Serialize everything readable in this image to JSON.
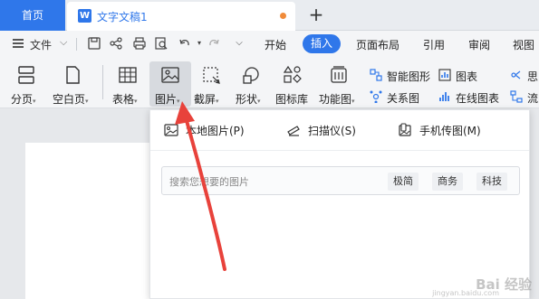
{
  "tabs": {
    "home": "首页",
    "document": "文字文稿1",
    "doc_icon": "W",
    "new_tab_icon": "+"
  },
  "menu": {
    "file": "文件",
    "items": [
      "开始",
      "插入",
      "页面布局",
      "引用",
      "审阅",
      "视图"
    ],
    "active": "插入"
  },
  "ribbon": {
    "buttons": [
      "分页",
      "空白页",
      "表格",
      "图片",
      "截屏",
      "形状",
      "图标库",
      "功能图"
    ],
    "small_right": [
      "智能图形",
      "关系图",
      "图表",
      "在线图表"
    ],
    "edge_labels": [
      "思",
      "流"
    ]
  },
  "dropdown": {
    "items": [
      "本地图片(P)",
      "扫描仪(S)",
      "手机传图(M)"
    ],
    "search_placeholder": "搜索您想要的图片",
    "tags": [
      "极简",
      "商务",
      "科技"
    ]
  },
  "colors": {
    "accent": "#2f77ea",
    "arrow": "#e8423b",
    "unsaved_dot": "#f08b3a"
  },
  "watermark": {
    "text": "Bai 经验",
    "sub": "jingyan.baidu.com"
  }
}
